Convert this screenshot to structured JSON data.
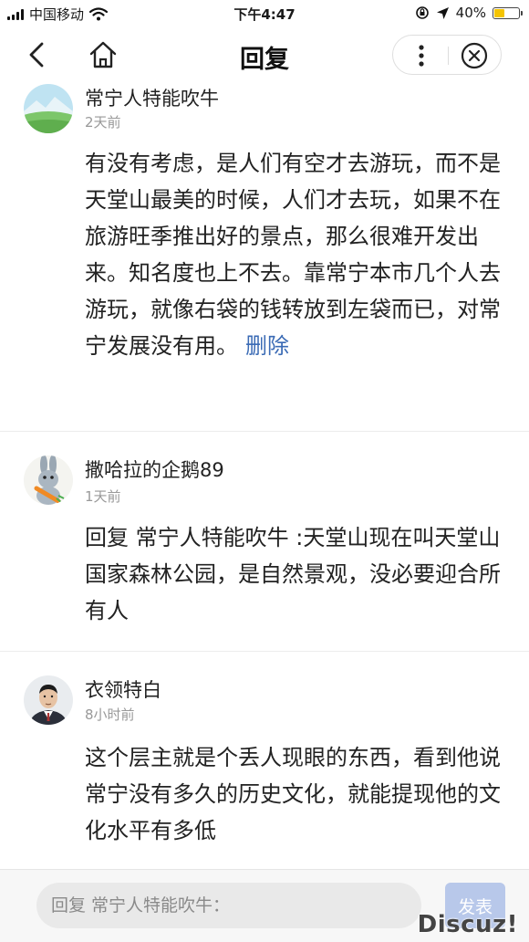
{
  "status_bar": {
    "carrier": "中国移动",
    "time": "下午4:47",
    "battery_percent": "40%",
    "battery_level": 0.4
  },
  "nav": {
    "title": "回复",
    "icons": [
      "back-arrow-icon",
      "home-icon",
      "more-dots-icon",
      "close-circle-icon"
    ]
  },
  "comments": [
    {
      "author": "常宁人特能吹牛",
      "time": "2天前",
      "content": "有没有考虑，是人们有空才去游玩，而不是天堂山最美的时候，人们才去玩，如果不在旅游旺季推出好的景点，那么很难开发出来。知名度也上不去。靠常宁本市几个人去游玩，就像右袋的钱转放到左袋而已，对常宁发展没有用。",
      "action": "删除"
    },
    {
      "author": "撒哈拉的企鹅89",
      "time": "1天前",
      "content": "回复 常宁人特能吹牛 :天堂山现在叫天堂山国家森林公园，是自然景观，没必要迎合所有人"
    },
    {
      "author": "衣领特白",
      "time": "8小时前",
      "content": "这个层主就是个丢人现眼的东西，看到他说常宁没有多久的历史文化，就能提现他的文化水平有多低"
    }
  ],
  "reply_bar": {
    "placeholder": "回复 常宁人特能吹牛：",
    "send_label": "发表"
  },
  "watermark": "Discuz!",
  "colors": {
    "link": "#3b6bb5",
    "send_button": "#b8c8ea",
    "battery": "#f5c400"
  }
}
